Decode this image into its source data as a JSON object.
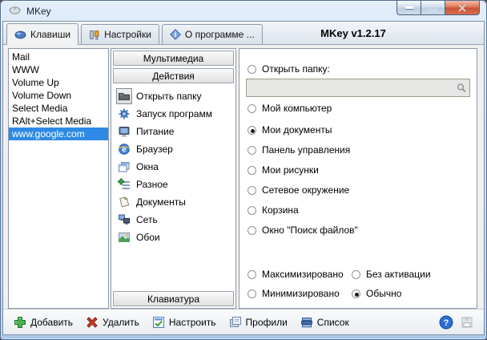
{
  "window": {
    "title": "MKey"
  },
  "tabs": {
    "items": [
      {
        "label": "Клавиши",
        "icon": "mouse-icon",
        "active": true
      },
      {
        "label": "Настройки",
        "icon": "settings-icon",
        "active": false
      },
      {
        "label": "О программе ...",
        "icon": "info-icon",
        "active": false
      }
    ],
    "version": "MKey v1.2.17"
  },
  "hotkeys": {
    "items": [
      {
        "label": "Mail",
        "selected": false
      },
      {
        "label": "WWW",
        "selected": false
      },
      {
        "label": "Volume Up",
        "selected": false
      },
      {
        "label": "Volume Down",
        "selected": false
      },
      {
        "label": "Select Media",
        "selected": false
      },
      {
        "label": "RAlt+Select Media",
        "selected": false
      },
      {
        "label": "www.google.com",
        "selected": true
      }
    ]
  },
  "categories": {
    "multimedia": "Мультимедиа",
    "actions": "Действия",
    "keyboard": "Клавиатура"
  },
  "actions": [
    {
      "label": "Открыть папку",
      "icon": "folder-icon",
      "selected": true
    },
    {
      "label": "Запуск программ",
      "icon": "launch-icon",
      "selected": false
    },
    {
      "label": "Питание",
      "icon": "power-icon",
      "selected": false
    },
    {
      "label": "Браузер",
      "icon": "browser-icon",
      "selected": false
    },
    {
      "label": "Окна",
      "icon": "windows-icon",
      "selected": false
    },
    {
      "label": "Разное",
      "icon": "misc-icon",
      "selected": false
    },
    {
      "label": "Документы",
      "icon": "documents-icon",
      "selected": false
    },
    {
      "label": "Сеть",
      "icon": "network-icon",
      "selected": false
    },
    {
      "label": "Обои",
      "icon": "wallpaper-icon",
      "selected": false
    }
  ],
  "folder_options": {
    "open_folder": {
      "label": "Открыть папку:",
      "checked": false
    },
    "path_input": {
      "value": "",
      "icon": "search-icon"
    },
    "radios": [
      {
        "label": "Мой компьютер",
        "checked": false
      },
      {
        "label": "Мои документы",
        "checked": true
      },
      {
        "label": "Панель управления",
        "checked": false
      },
      {
        "label": "Мои рисунки",
        "checked": false
      },
      {
        "label": "Сетевое окружение",
        "checked": false
      },
      {
        "label": "Корзина",
        "checked": false
      },
      {
        "label": "Окно \"Поиск файлов\"",
        "checked": false
      }
    ]
  },
  "window_state": {
    "left": [
      {
        "label": "Максимизировано",
        "checked": false
      },
      {
        "label": "Минимизировано",
        "checked": false
      }
    ],
    "right": [
      {
        "label": "Без активации",
        "checked": false
      },
      {
        "label": "Обычно",
        "checked": true
      }
    ]
  },
  "toolbar": {
    "buttons": [
      {
        "label": "Добавить",
        "icon": "add-icon"
      },
      {
        "label": "Удалить",
        "icon": "delete-icon"
      },
      {
        "label": "Настроить",
        "icon": "configure-icon"
      },
      {
        "label": "Профили",
        "icon": "profiles-icon"
      },
      {
        "label": "Список",
        "icon": "list-icon"
      }
    ],
    "help_icon": "help-icon",
    "save_icon": "save-icon"
  },
  "colors": {
    "selection": "#2e8ae4",
    "titlebar": "#c2d8ef",
    "close_button": "#c9553a"
  }
}
